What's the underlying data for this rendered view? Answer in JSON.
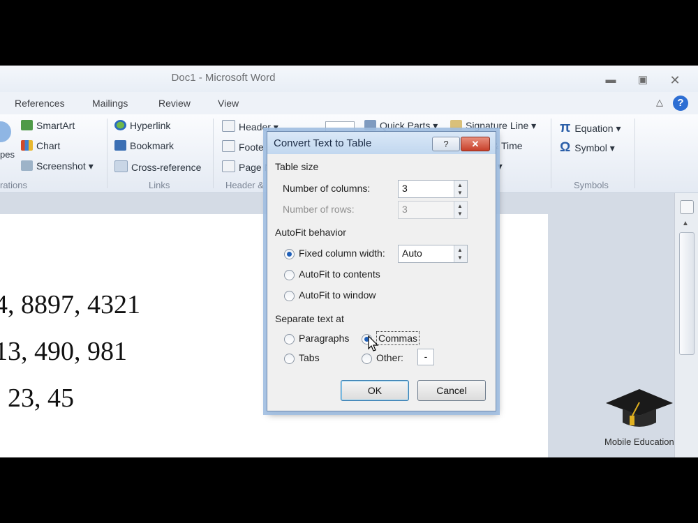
{
  "window": {
    "title": "Doc1  -  Microsoft Word",
    "minimize_icon": "minimize-icon",
    "restore_icon": "restore-icon",
    "close_icon": "close-icon"
  },
  "tabs": [
    "References",
    "Mailings",
    "Review",
    "View"
  ],
  "ribbon": {
    "illustrations": {
      "items": [
        "SmartArt",
        "Chart",
        "Screenshot"
      ],
      "partial_labels": [
        "pes",
        "rations"
      ]
    },
    "links": {
      "items": [
        "Hyperlink",
        "Bookmark",
        "Cross-reference"
      ],
      "group": "Links"
    },
    "header_footer": {
      "items": [
        "Header",
        "Foote",
        "Page N"
      ],
      "group": "Header &"
    },
    "text": {
      "items": [
        "Quick Parts",
        "Signature Line",
        "& Time"
      ]
    },
    "symbols": {
      "items": [
        "Equation",
        "Symbol"
      ],
      "group": "Symbols"
    }
  },
  "document": {
    "lines": [
      "4, 8897, 4321",
      "13, 490, 981",
      ", 23, 45"
    ]
  },
  "logo": {
    "label": "Mobile Education"
  },
  "dialog": {
    "title": "Convert Text to Table",
    "help": "?",
    "table_size": {
      "heading": "Table size",
      "columns_label": "Number of columns:",
      "columns_value": "3",
      "rows_label": "Number of rows:",
      "rows_value": "3"
    },
    "autofit": {
      "heading": "AutoFit behavior",
      "fixed_label": "Fixed column width:",
      "fixed_value": "Auto",
      "contents_label": "AutoFit to contents",
      "window_label": "AutoFit to window",
      "selected": "fixed"
    },
    "separate": {
      "heading": "Separate text at",
      "paragraphs": "Paragraphs",
      "commas": "Commas",
      "tabs": "Tabs",
      "other": "Other:",
      "other_value": "-",
      "selected": "commas"
    },
    "ok": "OK",
    "cancel": "Cancel"
  },
  "colors": {
    "accent": "#2d6ed3",
    "dialog_title": "#c1d7ef",
    "ribbon": "#e4eaf3"
  }
}
